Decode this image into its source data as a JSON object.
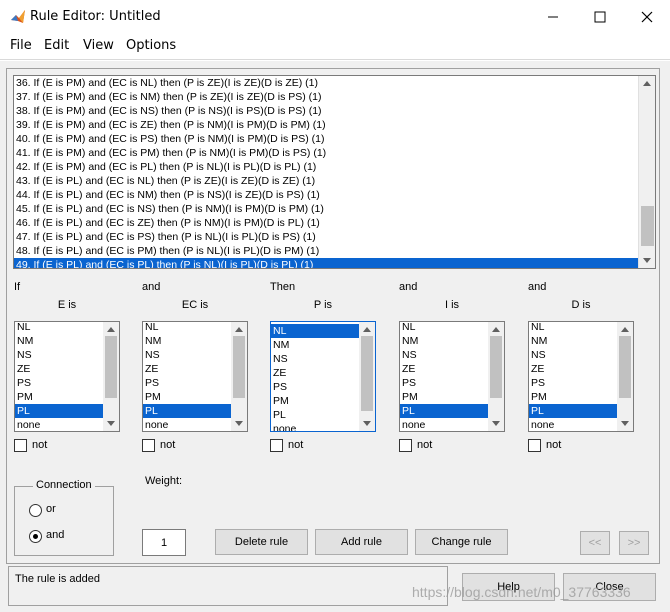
{
  "window": {
    "title": "Rule Editor: Untitled",
    "app_icon": "matlab-icon",
    "controls": [
      "minimize-icon",
      "maximize-icon",
      "close-icon"
    ]
  },
  "menu": {
    "items": [
      "File",
      "Edit",
      "View",
      "Options"
    ]
  },
  "rules": {
    "items": [
      "36. If (E is PM) and (EC is NL) then (P is ZE)(I is ZE)(D is ZE) (1)",
      "37. If (E is PM) and (EC is NM) then (P is ZE)(I is ZE)(D is PS) (1)",
      "38. If (E is PM) and (EC is NS) then (P is NS)(I is PS)(D is PS) (1)",
      "39. If (E is PM) and (EC is ZE) then (P is NM)(I is PM)(D is PM) (1)",
      "40. If (E is PM) and (EC is PS) then (P is NM)(I is PM)(D is PS) (1)",
      "41. If (E is PM) and (EC is PM) then (P is NM)(I is PM)(D is PS) (1)",
      "42. If (E is PM) and (EC is PL) then (P is NL)(I is PL)(D is PL) (1)",
      "43. If (E is PL) and (EC is NL) then (P is ZE)(I is ZE)(D is ZE) (1)",
      "44. If (E is PL) and (EC is NM) then (P is NS)(I is ZE)(D is PS) (1)",
      "45. If (E is PL) and (EC is NS) then (P is NM)(I is PM)(D is PM) (1)",
      "46. If (E is PL) and (EC is ZE) then (P is NM)(I is PM)(D is PL) (1)",
      "47. If (E is PL) and (EC is PS) then (P is NL)(I is PL)(D is PS) (1)",
      "48. If (E is PL) and (EC is PM) then (P is NL)(I is PL)(D is PM) (1)",
      "49. If (E is PL) and (EC is PL) then (P is NL)(I is PL)(D is PL) (1)"
    ],
    "selected_index": 13
  },
  "variables": [
    {
      "connector": "If",
      "name": "E is",
      "items": [
        "NL",
        "NM",
        "NS",
        "ZE",
        "PS",
        "PM",
        "PL",
        "none"
      ],
      "selected": "PL",
      "not_label": "not"
    },
    {
      "connector": "and",
      "name": "EC is",
      "items": [
        "NL",
        "NM",
        "NS",
        "ZE",
        "PS",
        "PM",
        "PL",
        "none"
      ],
      "selected": "PL",
      "not_label": "not"
    },
    {
      "connector": "Then",
      "name": "P is",
      "items": [
        "NL",
        "NM",
        "NS",
        "ZE",
        "PS",
        "PM",
        "PL",
        "none"
      ],
      "selected": "NL",
      "not_label": "not"
    },
    {
      "connector": "and",
      "name": "I is",
      "items": [
        "NL",
        "NM",
        "NS",
        "ZE",
        "PS",
        "PM",
        "PL",
        "none"
      ],
      "selected": "PL",
      "not_label": "not"
    },
    {
      "connector": "and",
      "name": "D is",
      "items": [
        "NL",
        "NM",
        "NS",
        "ZE",
        "PS",
        "PM",
        "PL",
        "none"
      ],
      "selected": "PL",
      "not_label": "not"
    }
  ],
  "connection": {
    "title": "Connection",
    "or_label": "or",
    "and_label": "and",
    "selected": "and"
  },
  "weight": {
    "label": "Weight:",
    "value": "1"
  },
  "buttons": {
    "delete": "Delete rule",
    "add": "Add rule",
    "change": "Change rule",
    "prev": "<<",
    "next": ">>",
    "help": "Help",
    "close": "Close"
  },
  "status": {
    "text": "The rule is added"
  },
  "watermark": "https://blog.csdn.net/m0_37763336",
  "colors": {
    "selection": "#0a64d0",
    "background": "#f0f0f0"
  }
}
